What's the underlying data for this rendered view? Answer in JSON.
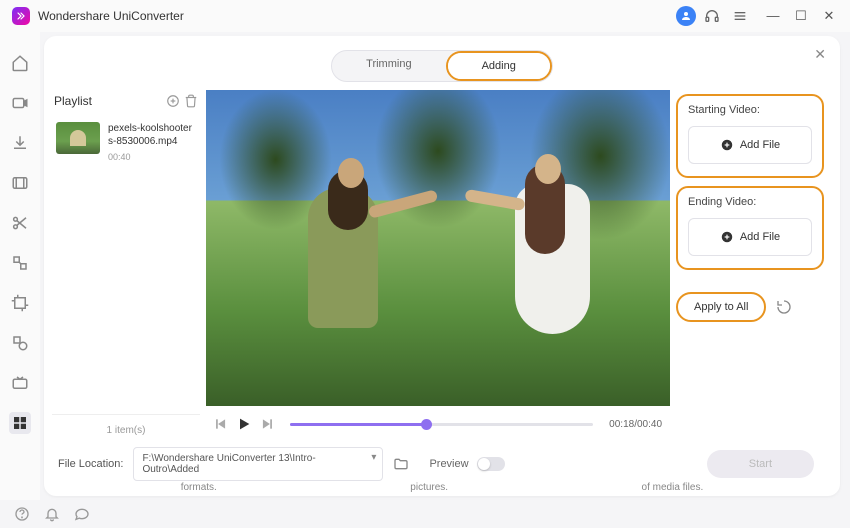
{
  "titlebar": {
    "app_title": "Wondershare UniConverter"
  },
  "tabs": {
    "trimming": "Trimming",
    "adding": "Adding"
  },
  "playlist": {
    "title": "Playlist",
    "items": [
      {
        "name": "pexels-koolshooters-8530006.mp4",
        "duration": "00:40"
      }
    ],
    "count_text": "1 item(s)"
  },
  "player": {
    "time": "00:18/00:40",
    "progress_pct": 45
  },
  "right": {
    "starting_label": "Starting Video:",
    "ending_label": "Ending Video:",
    "add_file": "Add File",
    "apply_all": "Apply to All"
  },
  "location": {
    "label": "File Location:",
    "path": "F:\\Wondershare UniConverter 13\\Intro-Outro\\Added",
    "preview": "Preview",
    "start": "Start"
  },
  "snippets": {
    "a": "formats.",
    "b": "pictures.",
    "c": "of media files."
  }
}
